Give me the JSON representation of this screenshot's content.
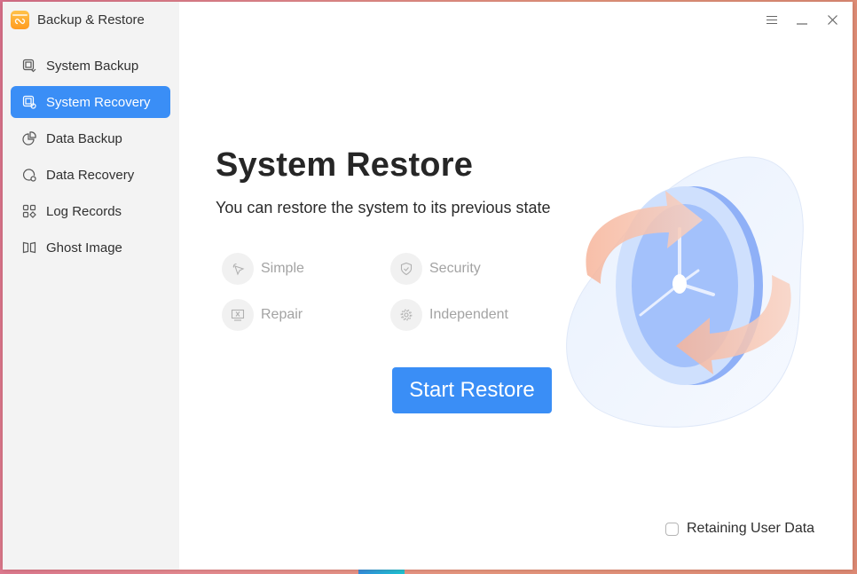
{
  "app": {
    "title": "Backup & Restore",
    "logo_icon": "backup-restore-logo-icon"
  },
  "window_controls": {
    "menu_icon": "hamburger-menu-icon",
    "minimize_icon": "minimize-icon",
    "close_icon": "close-icon"
  },
  "sidebar": {
    "items": [
      {
        "label": "System Backup",
        "icon": "system-backup-icon",
        "active": false
      },
      {
        "label": "System Recovery",
        "icon": "system-recovery-icon",
        "active": true
      },
      {
        "label": "Data Backup",
        "icon": "data-backup-icon",
        "active": false
      },
      {
        "label": "Data Recovery",
        "icon": "data-recovery-icon",
        "active": false
      },
      {
        "label": "Log Records",
        "icon": "log-records-icon",
        "active": false
      },
      {
        "label": "Ghost Image",
        "icon": "ghost-image-icon",
        "active": false
      }
    ]
  },
  "main": {
    "heading": "System Restore",
    "subtitle": "You can restore the system to its previous state",
    "features": [
      {
        "label": "Simple",
        "icon": "cursor-pointer-icon"
      },
      {
        "label": "Security",
        "icon": "shield-check-icon"
      },
      {
        "label": "Repair",
        "icon": "monitor-repair-icon"
      },
      {
        "label": "Independent",
        "icon": "gear-icon"
      }
    ],
    "start_button": "Start Restore",
    "illustration": "clock-restore-illustration",
    "retain_checkbox": {
      "label": "Retaining User Data",
      "checked": false
    }
  },
  "colors": {
    "accent": "#3a8ef6",
    "sidebar_bg": "#f3f3f3",
    "feature_text": "#a3a3a3"
  }
}
